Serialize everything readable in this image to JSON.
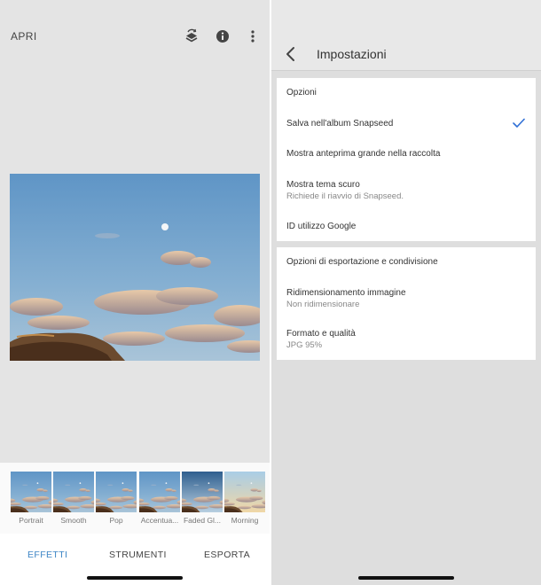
{
  "left": {
    "open_label": "APRI",
    "icons": {
      "history": "layers-history-icon",
      "info": "info-icon",
      "menu": "more-vert-icon"
    },
    "filters": [
      {
        "label": "Portrait"
      },
      {
        "label": "Smooth"
      },
      {
        "label": "Pop"
      },
      {
        "label": "Accentua..."
      },
      {
        "label": "Faded Gl..."
      },
      {
        "label": "Morning"
      }
    ],
    "tabs": [
      {
        "label": "EFFETTI",
        "active": true
      },
      {
        "label": "STRUMENTI",
        "active": false
      },
      {
        "label": "ESPORTA",
        "active": false
      }
    ]
  },
  "right": {
    "title": "Impostazioni",
    "sections": [
      {
        "title": "Opzioni",
        "items": [
          {
            "label": "Salva nell'album Snapseed",
            "checked": true
          },
          {
            "label": "Mostra anteprima grande nella raccolta"
          },
          {
            "label": "Mostra tema scuro",
            "sublabel": "Richiede il riavvio di Snapseed."
          },
          {
            "label": "ID utilizzo Google"
          }
        ]
      },
      {
        "title": "Opzioni di esportazione e condivisione",
        "items": [
          {
            "label": "Ridimensionamento immagine",
            "sublabel": "Non ridimensionare"
          },
          {
            "label": "Formato e qualità",
            "sublabel": "JPG 95%"
          }
        ]
      }
    ]
  },
  "colors": {
    "accent": "#3d86c6",
    "check": "#2f6fd6"
  }
}
